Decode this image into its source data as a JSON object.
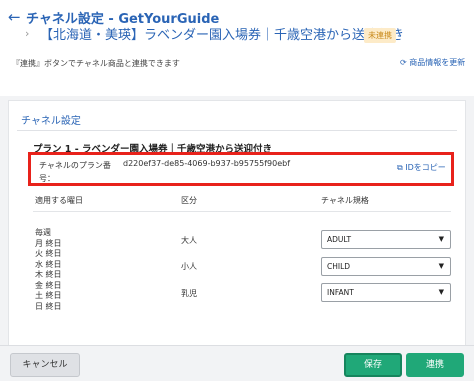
{
  "header": {
    "back_icon": "arrow-left-icon",
    "title": "チャネル設定 - GetYourGuide",
    "product_name": "【北海道・美瑛】ラベンダー園入場券｜千歳空港から送迎付き",
    "status_badge": "未連携",
    "hint": "『連携』ボタンでチャネル商品と連携できます",
    "refresh_label": "商品情報を更新"
  },
  "section": {
    "title": "チャネル設定"
  },
  "plan": {
    "title": "プラン 1 - ラベンダー園入場券｜千歳空港から送迎付き",
    "id_label": "チャネルのプラン番号：",
    "id_value": "d220ef37-de85-4069-b937-b95755f90ebf",
    "copy_label": "IDをコピー"
  },
  "table": {
    "headers": [
      "適用する曜日",
      "区分",
      "チャネル規格"
    ],
    "days": [
      "毎週",
      "月 終日",
      "火 終日",
      "水 終日",
      "木 終日",
      "金 終日",
      "土 終日",
      "日 終日"
    ],
    "rows": [
      {
        "category": "大人",
        "value": "ADULT"
      },
      {
        "category": "小人",
        "value": "CHILD"
      },
      {
        "category": "乳児",
        "value": "INFANT"
      }
    ]
  },
  "footer": {
    "cancel_label": "キャンセル",
    "save_label": "保存",
    "link_label": "連携"
  },
  "colors": {
    "accent": "#2a64b5",
    "highlight_border": "#e8221b",
    "primary_button": "#20a878"
  }
}
